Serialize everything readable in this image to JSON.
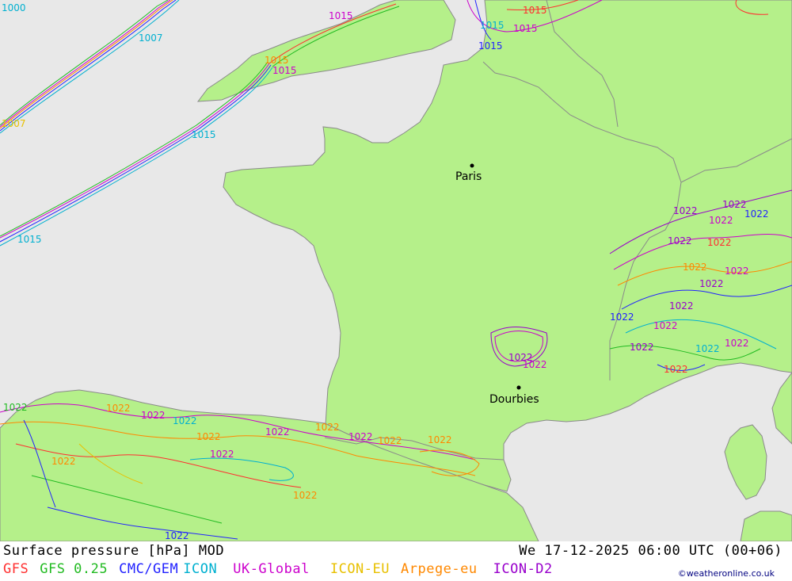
{
  "map": {
    "colors": {
      "sea": "#e8e8e8",
      "land": "#b5f08a",
      "border": "#8a8a8a"
    },
    "cities": [
      {
        "name": "Paris"
      },
      {
        "name": "Dourbies"
      }
    ],
    "isobar_labels": [
      "1000",
      "1007",
      "1015",
      "1015",
      "1015",
      "1015",
      "1015",
      "1015",
      "1015",
      "1007",
      "1015",
      "1015",
      "1022",
      "1022",
      "1022",
      "1022",
      "1022",
      "1022",
      "1022",
      "1022",
      "1022",
      "1022",
      "1022",
      "1022",
      "1022",
      "1022",
      "1022",
      "1022",
      "1022",
      "1022",
      "1022",
      "1022",
      "1022",
      "1022",
      "1022",
      "1022",
      "1022",
      "1022",
      "1022",
      "1022",
      "1022",
      "1022",
      "1022",
      "1022"
    ]
  },
  "footer": {
    "title": "Surface pressure [hPa] MOD",
    "time": "We 17-12-2025 06:00 UTC (00+06)",
    "models": [
      {
        "label": "GFS",
        "color": "#ff3030"
      },
      {
        "label": "GFS 0.25",
        "color": "#22bb22"
      },
      {
        "label": "CMC/GEM",
        "color": "#2222ff"
      },
      {
        "label": "ICON",
        "color": "#00b0d0"
      },
      {
        "label": "UK-Global",
        "color": "#cc00cc"
      },
      {
        "label": "ICON-EU",
        "color": "#e8c000"
      },
      {
        "label": "Arpege-eu",
        "color": "#ff8800"
      },
      {
        "label": "ICON-D2",
        "color": "#9900cc"
      }
    ],
    "credit": "©weatheronline.co.uk"
  }
}
